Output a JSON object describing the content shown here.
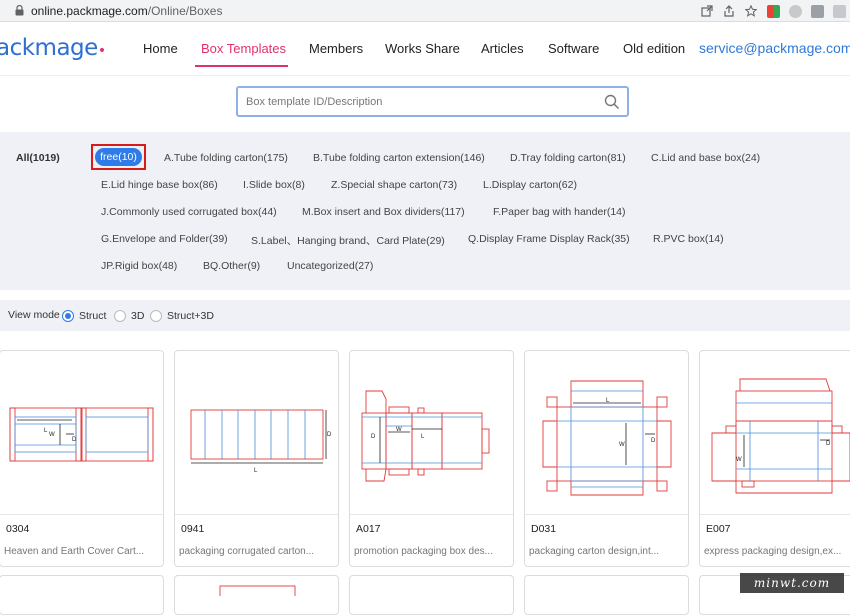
{
  "browser": {
    "url_host": "online.packmage.com",
    "url_path": "/Online/Boxes",
    "icons": [
      "lock-icon",
      "open-tab-icon",
      "share-icon",
      "star-icon",
      "extension-icon",
      "extension-icon",
      "extension-icon",
      "extension-icon"
    ]
  },
  "header": {
    "logo": "ackmage",
    "nav": [
      {
        "label": "Home",
        "active": false
      },
      {
        "label": "Box Templates",
        "active": true
      },
      {
        "label": "Members",
        "active": false
      },
      {
        "label": "Works Share",
        "active": false
      },
      {
        "label": "Articles",
        "active": false
      },
      {
        "label": "Software",
        "active": false
      },
      {
        "label": "Old edition",
        "active": false
      }
    ],
    "service_email": "service@packmage.com",
    "accent_color": "#e2316f",
    "link_color": "#2e7ad6"
  },
  "search": {
    "placeholder": "Box template ID/Description"
  },
  "categories": {
    "all": "All(1019)",
    "selected": "free(10)",
    "items": [
      "A.Tube folding carton(175)",
      "B.Tube folding carton extension(146)",
      "D.Tray folding carton(81)",
      "C.Lid and base box(24)",
      "E.Lid hinge base box(86)",
      "I.Slide box(8)",
      "Z.Special shape carton(73)",
      "L.Display carton(62)",
      "J.Commonly used corrugated box(44)",
      "M.Box insert and Box dividers(117)",
      "F.Paper bag with hander(14)",
      "G.Envelope and Folder(39)",
      "S.Label、Hanging brand、Card Plate(29)",
      "Q.Display Frame Display Rack(35)",
      "R.PVC box(14)",
      "JP.Rigid box(48)",
      "BQ.Other(9)",
      "Uncategorized(27)"
    ],
    "selected_color": "#2f7be8"
  },
  "view_mode": {
    "label": "View mode",
    "options": [
      "Struct",
      "3D",
      "Struct+3D"
    ],
    "selected": "Struct"
  },
  "cards": [
    {
      "code": "0304",
      "desc": "Heaven and Earth Cover Cart...",
      "labels": [
        "L",
        "W",
        "D"
      ]
    },
    {
      "code": "0941",
      "desc": "packaging corrugated carton...",
      "labels": [
        "D",
        "L"
      ]
    },
    {
      "code": "A017",
      "desc": "promotion packaging box des...",
      "labels": [
        "D",
        "W",
        "L"
      ]
    },
    {
      "code": "D031",
      "desc": "packaging carton design,int...",
      "labels": [
        "L",
        "W",
        "D"
      ]
    },
    {
      "code": "E007",
      "desc": "express packaging design,ex...",
      "labels": [
        "D",
        "W"
      ]
    }
  ],
  "watermark": "minwt.com"
}
